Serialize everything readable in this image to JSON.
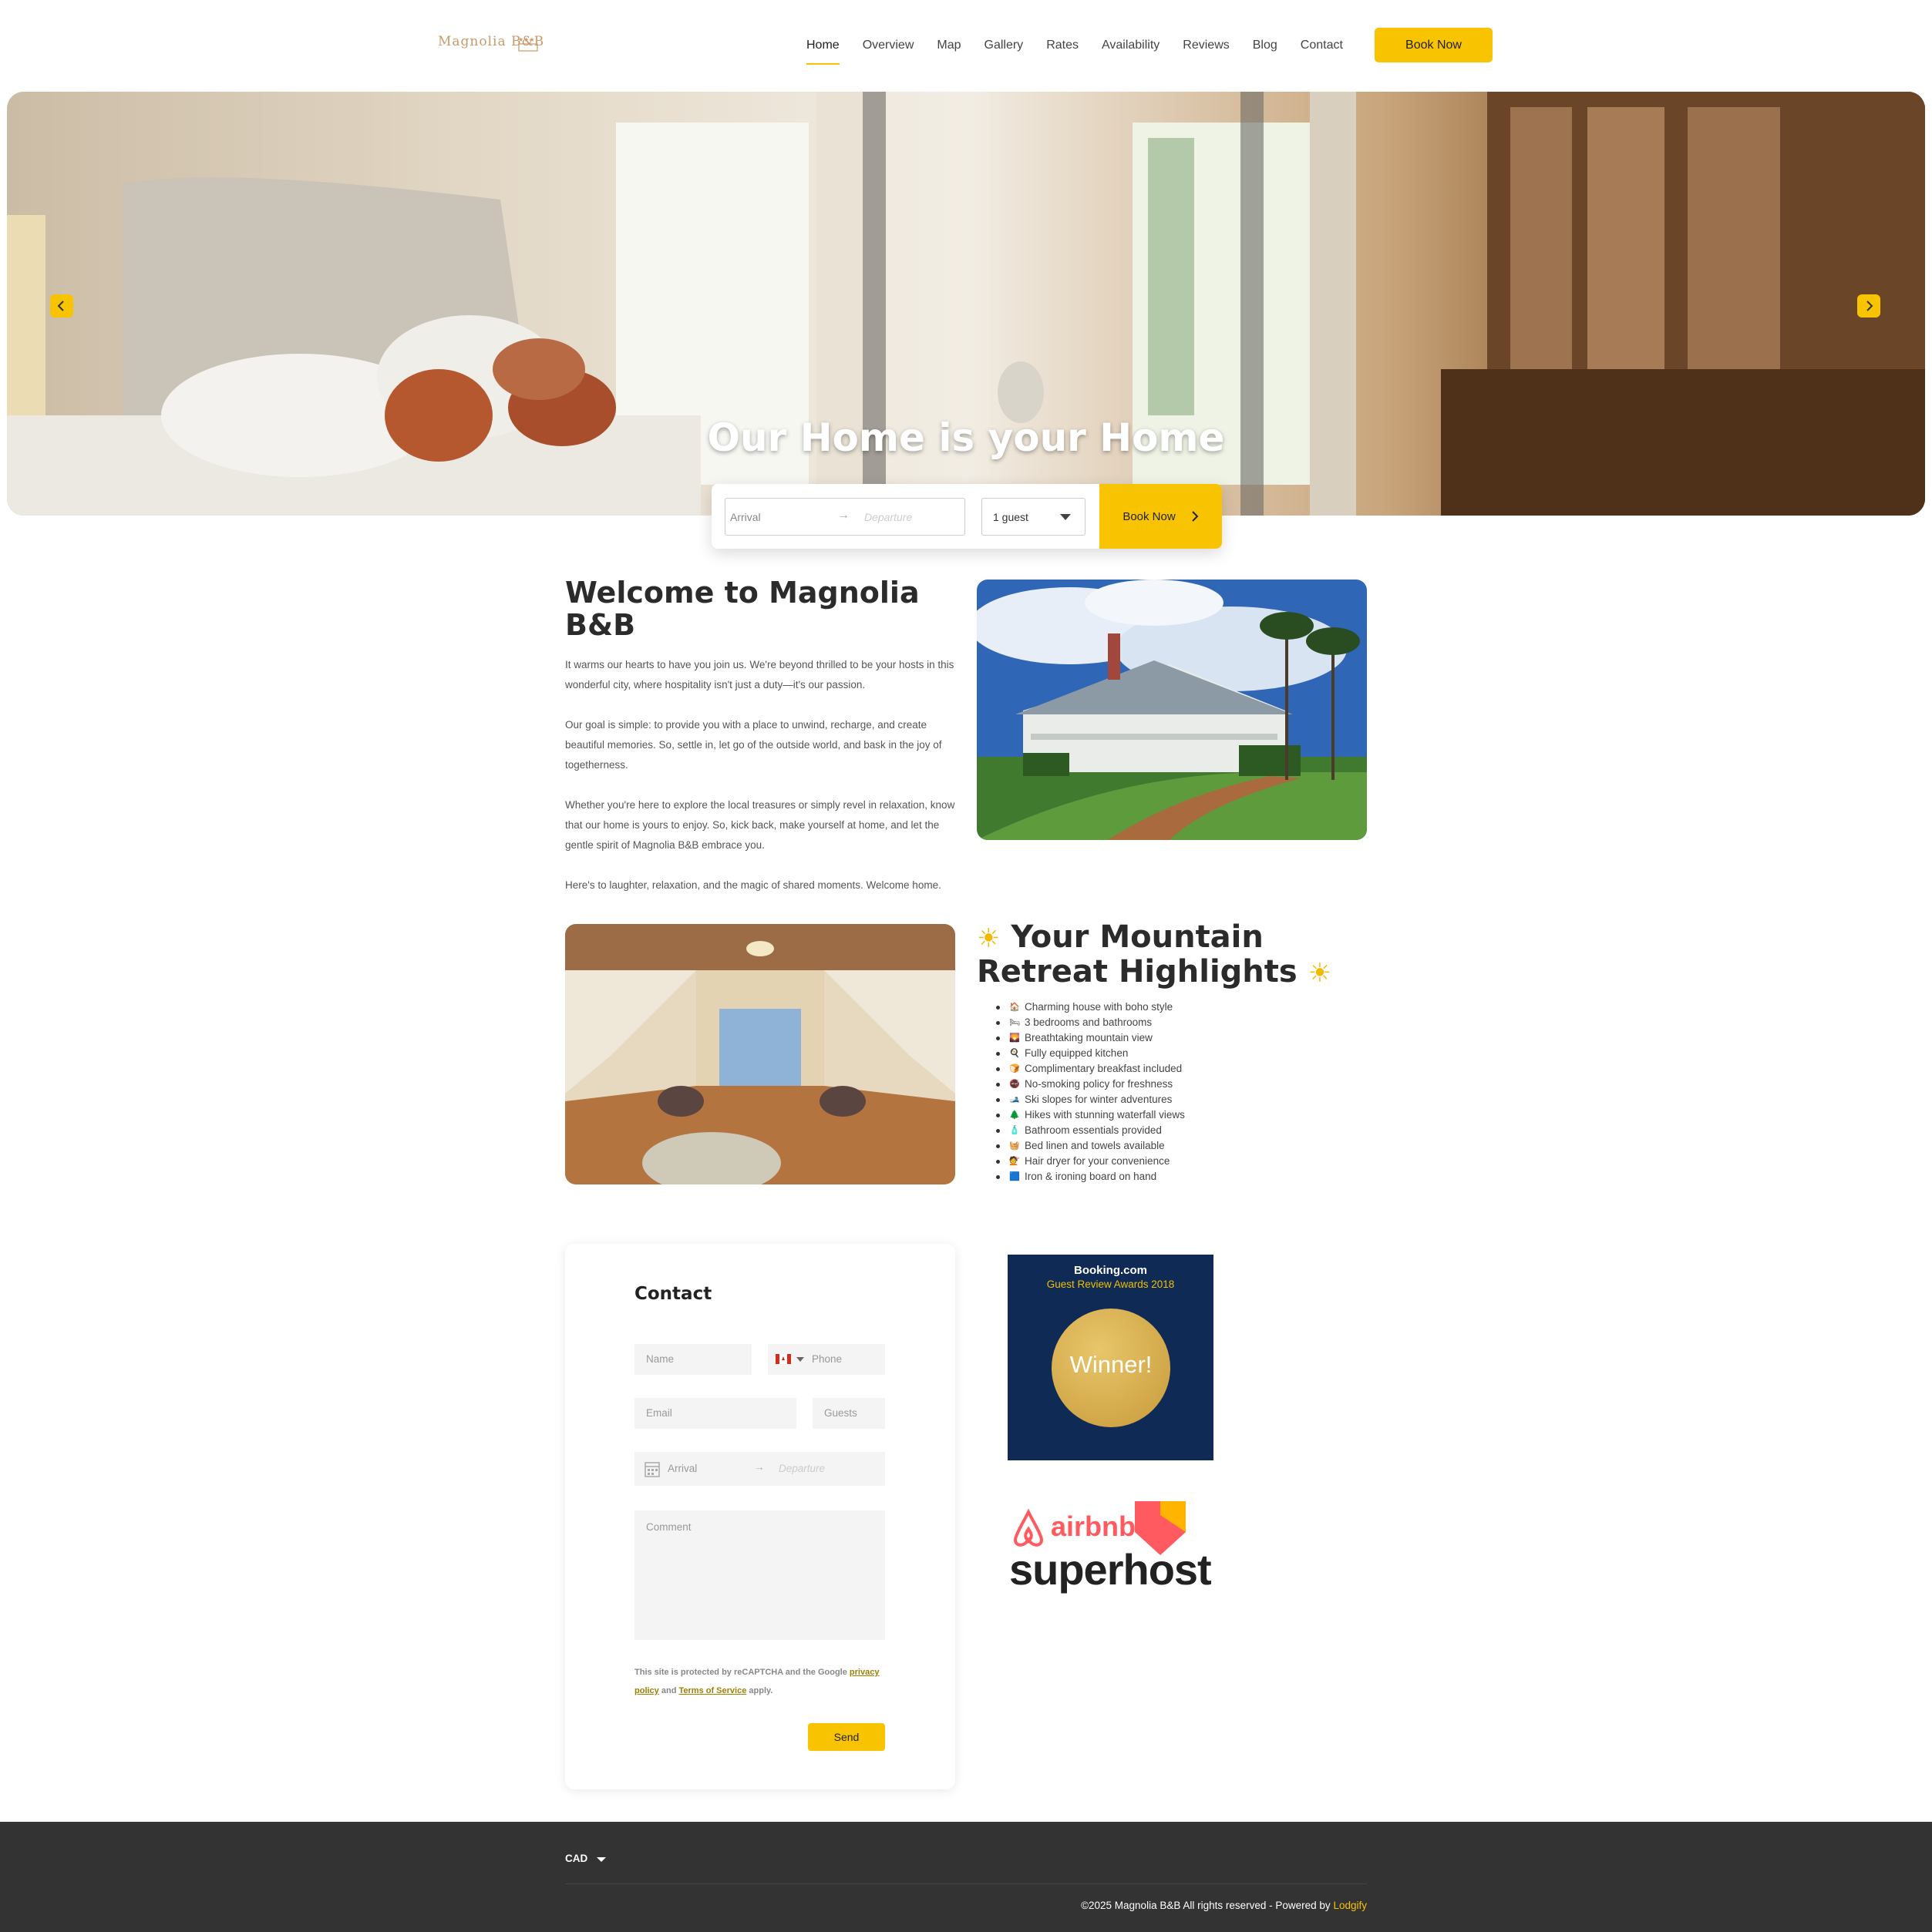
{
  "header": {
    "logo": "Magnolia B&B",
    "nav": [
      "Home",
      "Overview",
      "Map",
      "Gallery",
      "Rates",
      "Availability",
      "Reviews",
      "Blog",
      "Contact"
    ],
    "active": "Home",
    "book_label": "Book Now"
  },
  "hero": {
    "title": "Our Home is your Home",
    "prev_icon": "chevron-left-icon",
    "next_icon": "chevron-right-icon"
  },
  "booking_bar": {
    "arrival_placeholder": "Arrival",
    "departure_placeholder": "Departure",
    "guests_value": "1 guest",
    "book_label": "Book Now"
  },
  "welcome": {
    "title": "Welcome to Magnolia B&B",
    "paragraphs": [
      "It warms our hearts to have you join us. We're beyond thrilled to be your hosts in this wonderful city, where hospitality isn't just a duty—it's our passion.",
      "Our goal is simple: to provide you with a place to unwind, recharge, and create beautiful memories. So, settle in, let go of the outside world, and bask in the joy of togetherness.",
      "Whether you're here to explore the local treasures or simply revel in relaxation, know that our home is yours to enjoy. So, kick back, make yourself at home, and let the gentle spirit of Magnolia B&B embrace you.",
      "Here's to laughter, relaxation, and the magic of shared moments. Welcome home."
    ]
  },
  "highlights": {
    "title": "Your Mountain Retreat Highlights",
    "title_icon": "sun-icon",
    "items": [
      {
        "icon": "🏠",
        "text": "Charming house with boho style"
      },
      {
        "icon": "🛏",
        "text": "3 bedrooms and bathrooms"
      },
      {
        "icon": "🌄",
        "text": "Breathtaking mountain view"
      },
      {
        "icon": "🍳",
        "text": "Fully equipped kitchen"
      },
      {
        "icon": "🍞",
        "text": "Complimentary breakfast included"
      },
      {
        "icon": "🚭",
        "text": "No-smoking policy for freshness"
      },
      {
        "icon": "🎿",
        "text": "Ski slopes for winter adventures"
      },
      {
        "icon": "🌲",
        "text": "Hikes with stunning waterfall views"
      },
      {
        "icon": "🧴",
        "text": "Bathroom essentials provided"
      },
      {
        "icon": "🧺",
        "text": "Bed linen and towels available"
      },
      {
        "icon": "💇",
        "text": "Hair dryer for your convenience"
      },
      {
        "icon": "🟦",
        "text": "Iron & ironing board on hand"
      }
    ]
  },
  "contact": {
    "title": "Contact",
    "name_placeholder": "Name",
    "phone_placeholder": "Phone",
    "email_placeholder": "Email",
    "guests_placeholder": "Guests",
    "arrival_placeholder": "Arrival",
    "departure_placeholder": "Departure",
    "comment_placeholder": "Comment",
    "recaptcha_prefix": "This site is protected by reCAPTCHA and the Google",
    "privacy_link": "privacy policy",
    "and_text": "and",
    "terms_link": "Terms of Service",
    "apply_text": "apply.",
    "send_label": "Send"
  },
  "badges": {
    "booking_title": "Booking.com",
    "booking_sub": "Guest Review Awards 2018",
    "booking_win": "Winner!",
    "airbnb_word": "airbnb",
    "superhost": "superhost"
  },
  "footer": {
    "currency": "CAD",
    "copyright": "©2025 Magnolia B&B All rights reserved - Powered by",
    "powered": "Lodgify"
  },
  "colors": {
    "accent": "#f8c300",
    "footer": "#333333"
  }
}
